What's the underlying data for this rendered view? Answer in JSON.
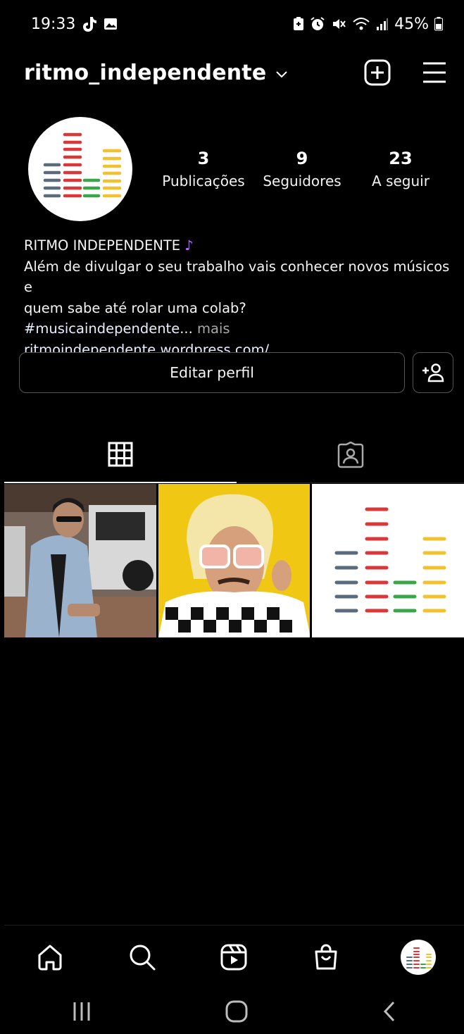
{
  "status_bar": {
    "time": "19:33",
    "battery": "45%",
    "icons": [
      "tiktok-icon",
      "gallery-icon",
      "battery-saver-icon",
      "alarm-icon",
      "mute-icon",
      "wifi-icon",
      "signal-icon",
      "battery-icon"
    ]
  },
  "header": {
    "username": "ritmo_independente",
    "icons": [
      "chevron-down-icon",
      "new-post-icon",
      "menu-icon"
    ]
  },
  "profile": {
    "stats": [
      {
        "value": "3",
        "label": "Publicações"
      },
      {
        "value": "9",
        "label": "Seguidores"
      },
      {
        "value": "23",
        "label": "A seguir"
      }
    ],
    "bio": {
      "name": "RITMO INDEPENDENTE",
      "name_emoji": "♪",
      "line1": "Além de divulgar o seu trabalho vais conhecer novos músicos e",
      "line2": "quem sabe até rolar uma colab?",
      "hashtag": "#musicaindependente",
      "ellipsis": "...",
      "more": " mais",
      "link": "ritmoindependente.wordpress.com/"
    },
    "edit_button": "Editar perfil"
  },
  "tabs": [
    "grid-icon",
    "tagged-icon"
  ],
  "bottom_nav": [
    "home-icon",
    "search-icon",
    "reels-icon",
    "shop-icon",
    "profile-avatar"
  ],
  "system_nav": [
    "recents-icon",
    "home-button-icon",
    "back-icon"
  ],
  "colors": {
    "background": "#000000",
    "logo_gray": "#5a6b7c",
    "logo_red": "#d9373a",
    "logo_green": "#3aa64a",
    "logo_yellow": "#f2c12e",
    "post_yellow": "#f0c814"
  }
}
